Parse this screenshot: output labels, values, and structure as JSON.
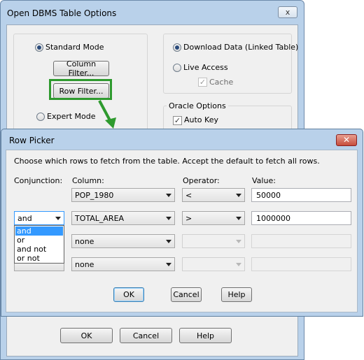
{
  "back_dialog": {
    "title": "Open DBMS Table Options",
    "close_glyph": "x",
    "standard_mode": "Standard Mode",
    "column_filter": "Column Filter...",
    "row_filter": "Row Filter...",
    "expert_mode": "Expert Mode",
    "download_data": "Download Data (Linked Table)",
    "live_access": "Live Access",
    "cache": "Cache",
    "oracle_options": "Oracle Options",
    "auto_key": "Auto Key",
    "ok": "OK",
    "cancel": "Cancel",
    "help": "Help"
  },
  "row_picker": {
    "title": "Row Picker",
    "close_glyph": "✕",
    "instructions": "Choose which rows to fetch from the table.  Accept the default to fetch all rows.",
    "headers": {
      "conjunction": "Conjunction:",
      "column": "Column:",
      "operator": "Operator:",
      "value": "Value:"
    },
    "rows": [
      {
        "conjunction": "",
        "column": "POP_1980",
        "operator": "<",
        "value": "50000"
      },
      {
        "conjunction": "and",
        "column": "TOTAL_AREA",
        "operator": ">",
        "value": "1000000"
      },
      {
        "conjunction": "",
        "column": "none",
        "operator": "",
        "value": ""
      },
      {
        "conjunction": "",
        "column": "none",
        "operator": "",
        "value": ""
      }
    ],
    "conjunction_options": [
      "and",
      "or",
      "and not",
      "or not"
    ],
    "ok": "OK",
    "cancel": "Cancel",
    "help": "Help"
  },
  "colors": {
    "highlight": "#2e9a2e",
    "selection": "#3399ff",
    "title_bar": "#b9d1ea"
  }
}
